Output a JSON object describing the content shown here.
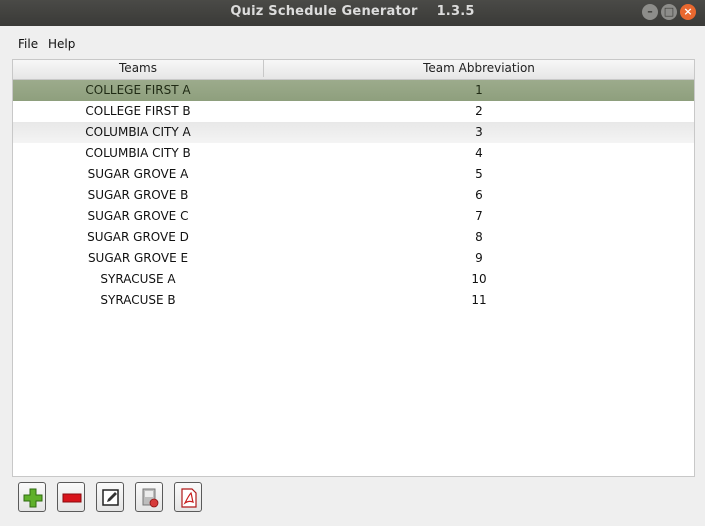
{
  "window": {
    "title": "Quiz Schedule Generator    1.3.5"
  },
  "menu": {
    "file": "File",
    "help": "Help"
  },
  "table": {
    "headers": {
      "teams": "Teams",
      "abbr": "Team Abbreviation"
    },
    "rows": [
      {
        "team": "COLLEGE FIRST A",
        "abbr": "1"
      },
      {
        "team": "COLLEGE FIRST B",
        "abbr": "2"
      },
      {
        "team": "COLUMBIA CITY A",
        "abbr": "3"
      },
      {
        "team": "COLUMBIA CITY B",
        "abbr": "4"
      },
      {
        "team": "SUGAR GROVE A",
        "abbr": "5"
      },
      {
        "team": "SUGAR GROVE B",
        "abbr": "6"
      },
      {
        "team": "SUGAR GROVE C",
        "abbr": "7"
      },
      {
        "team": "SUGAR GROVE D",
        "abbr": "8"
      },
      {
        "team": "SUGAR GROVE E",
        "abbr": "9"
      },
      {
        "team": "SYRACUSE A",
        "abbr": "10"
      },
      {
        "team": "SYRACUSE B",
        "abbr": "11"
      }
    ],
    "selected_row": 0
  },
  "toolbar": {
    "icons": [
      "add-icon",
      "remove-icon",
      "edit-icon",
      "export-icon",
      "pdf-icon"
    ]
  },
  "colors": {
    "selection": "#93a382",
    "titlebar": "#3c3b37",
    "close": "#e9682f"
  }
}
